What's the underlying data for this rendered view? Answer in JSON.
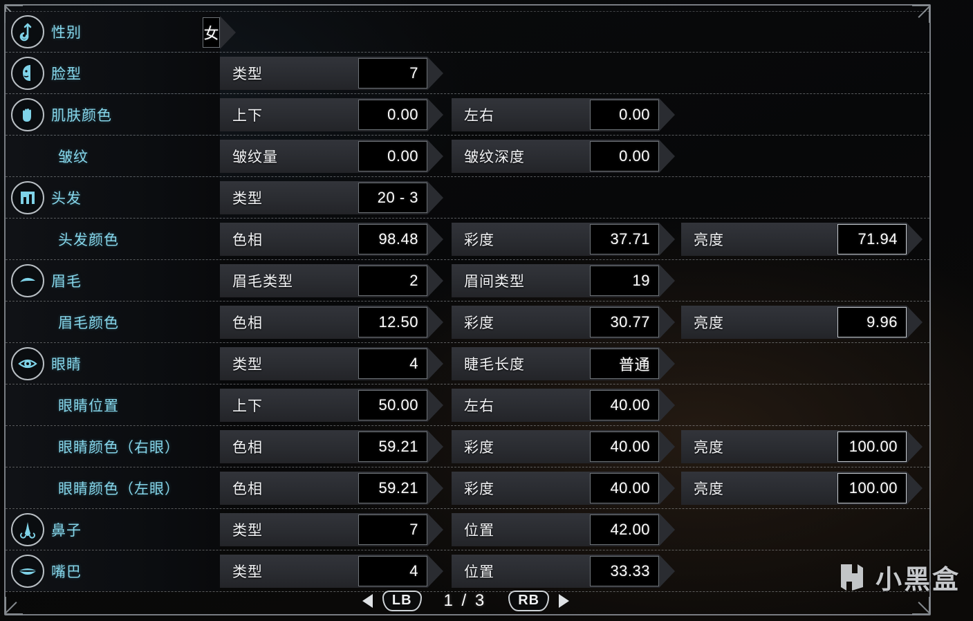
{
  "frame": {
    "accent_color": "#86d6ea",
    "border_color": "#8d9299"
  },
  "rows": [
    {
      "icon": "gender-icon",
      "label": "性别",
      "fields": [
        {
          "type": "full",
          "name": "",
          "value": "女",
          "highlight": false
        }
      ]
    },
    {
      "icon": "face-icon",
      "label": "脸型",
      "fields": [
        {
          "type": "c1",
          "name": "类型",
          "value": "7",
          "highlight": false
        }
      ]
    },
    {
      "icon": "hand-icon",
      "label": "肌肤颜色",
      "fields": [
        {
          "type": "c1",
          "name": "上下",
          "value": "0.00",
          "highlight": false
        },
        {
          "type": "c2",
          "name": "左右",
          "value": "0.00",
          "highlight": false
        }
      ]
    },
    {
      "icon": "",
      "label": "皱纹",
      "fields": [
        {
          "type": "c1",
          "name": "皱纹量",
          "value": "0.00",
          "highlight": false
        },
        {
          "type": "c2",
          "name": "皱纹深度",
          "value": "0.00",
          "highlight": false
        }
      ]
    },
    {
      "icon": "hair-icon",
      "label": "头发",
      "fields": [
        {
          "type": "c1",
          "name": "类型",
          "value": "20 - 3",
          "highlight": false
        }
      ]
    },
    {
      "icon": "",
      "label": "头发颜色",
      "fields": [
        {
          "type": "c1",
          "name": "色相",
          "value": "98.48",
          "highlight": false
        },
        {
          "type": "c2",
          "name": "彩度",
          "value": "37.71",
          "highlight": false
        },
        {
          "type": "c3",
          "name": "亮度",
          "value": "71.94",
          "highlight": true
        }
      ]
    },
    {
      "icon": "eyebrow-icon",
      "label": "眉毛",
      "fields": [
        {
          "type": "c1",
          "name": "眉毛类型",
          "value": "2",
          "highlight": false
        },
        {
          "type": "c2",
          "name": "眉间类型",
          "value": "19",
          "highlight": false
        }
      ]
    },
    {
      "icon": "",
      "label": "眉毛颜色",
      "fields": [
        {
          "type": "c1",
          "name": "色相",
          "value": "12.50",
          "highlight": false
        },
        {
          "type": "c2",
          "name": "彩度",
          "value": "30.77",
          "highlight": false
        },
        {
          "type": "c3",
          "name": "亮度",
          "value": "9.96",
          "highlight": true
        }
      ]
    },
    {
      "icon": "eye-icon",
      "label": "眼睛",
      "fields": [
        {
          "type": "c1",
          "name": "类型",
          "value": "4",
          "highlight": false
        },
        {
          "type": "c2",
          "name": "睫毛长度",
          "value": "普通",
          "highlight": false
        }
      ]
    },
    {
      "icon": "",
      "label": "眼睛位置",
      "fields": [
        {
          "type": "c1",
          "name": "上下",
          "value": "50.00",
          "highlight": false
        },
        {
          "type": "c2",
          "name": "左右",
          "value": "40.00",
          "highlight": false
        }
      ]
    },
    {
      "icon": "",
      "label": "眼睛颜色（右眼）",
      "fields": [
        {
          "type": "c1",
          "name": "色相",
          "value": "59.21",
          "highlight": false
        },
        {
          "type": "c2",
          "name": "彩度",
          "value": "40.00",
          "highlight": false
        },
        {
          "type": "c3",
          "name": "亮度",
          "value": "100.00",
          "highlight": true
        }
      ]
    },
    {
      "icon": "",
      "label": "眼睛颜色（左眼）",
      "fields": [
        {
          "type": "c1",
          "name": "色相",
          "value": "59.21",
          "highlight": false
        },
        {
          "type": "c2",
          "name": "彩度",
          "value": "40.00",
          "highlight": false
        },
        {
          "type": "c3",
          "name": "亮度",
          "value": "100.00",
          "highlight": true
        }
      ]
    },
    {
      "icon": "nose-icon",
      "label": "鼻子",
      "fields": [
        {
          "type": "c1",
          "name": "类型",
          "value": "7",
          "highlight": false
        },
        {
          "type": "c2",
          "name": "位置",
          "value": "42.00",
          "highlight": false
        }
      ]
    },
    {
      "icon": "mouth-icon",
      "label": "嘴巴",
      "fields": [
        {
          "type": "c1",
          "name": "类型",
          "value": "4",
          "highlight": false
        },
        {
          "type": "c2",
          "name": "位置",
          "value": "33.33",
          "highlight": false
        }
      ]
    }
  ],
  "pagenav": {
    "prev_bumper": "LB",
    "next_bumper": "RB",
    "page_indicator": "1 / 3"
  },
  "watermark": {
    "text": "小黑盒",
    "logo": "xiaoheihe-logo-icon"
  }
}
